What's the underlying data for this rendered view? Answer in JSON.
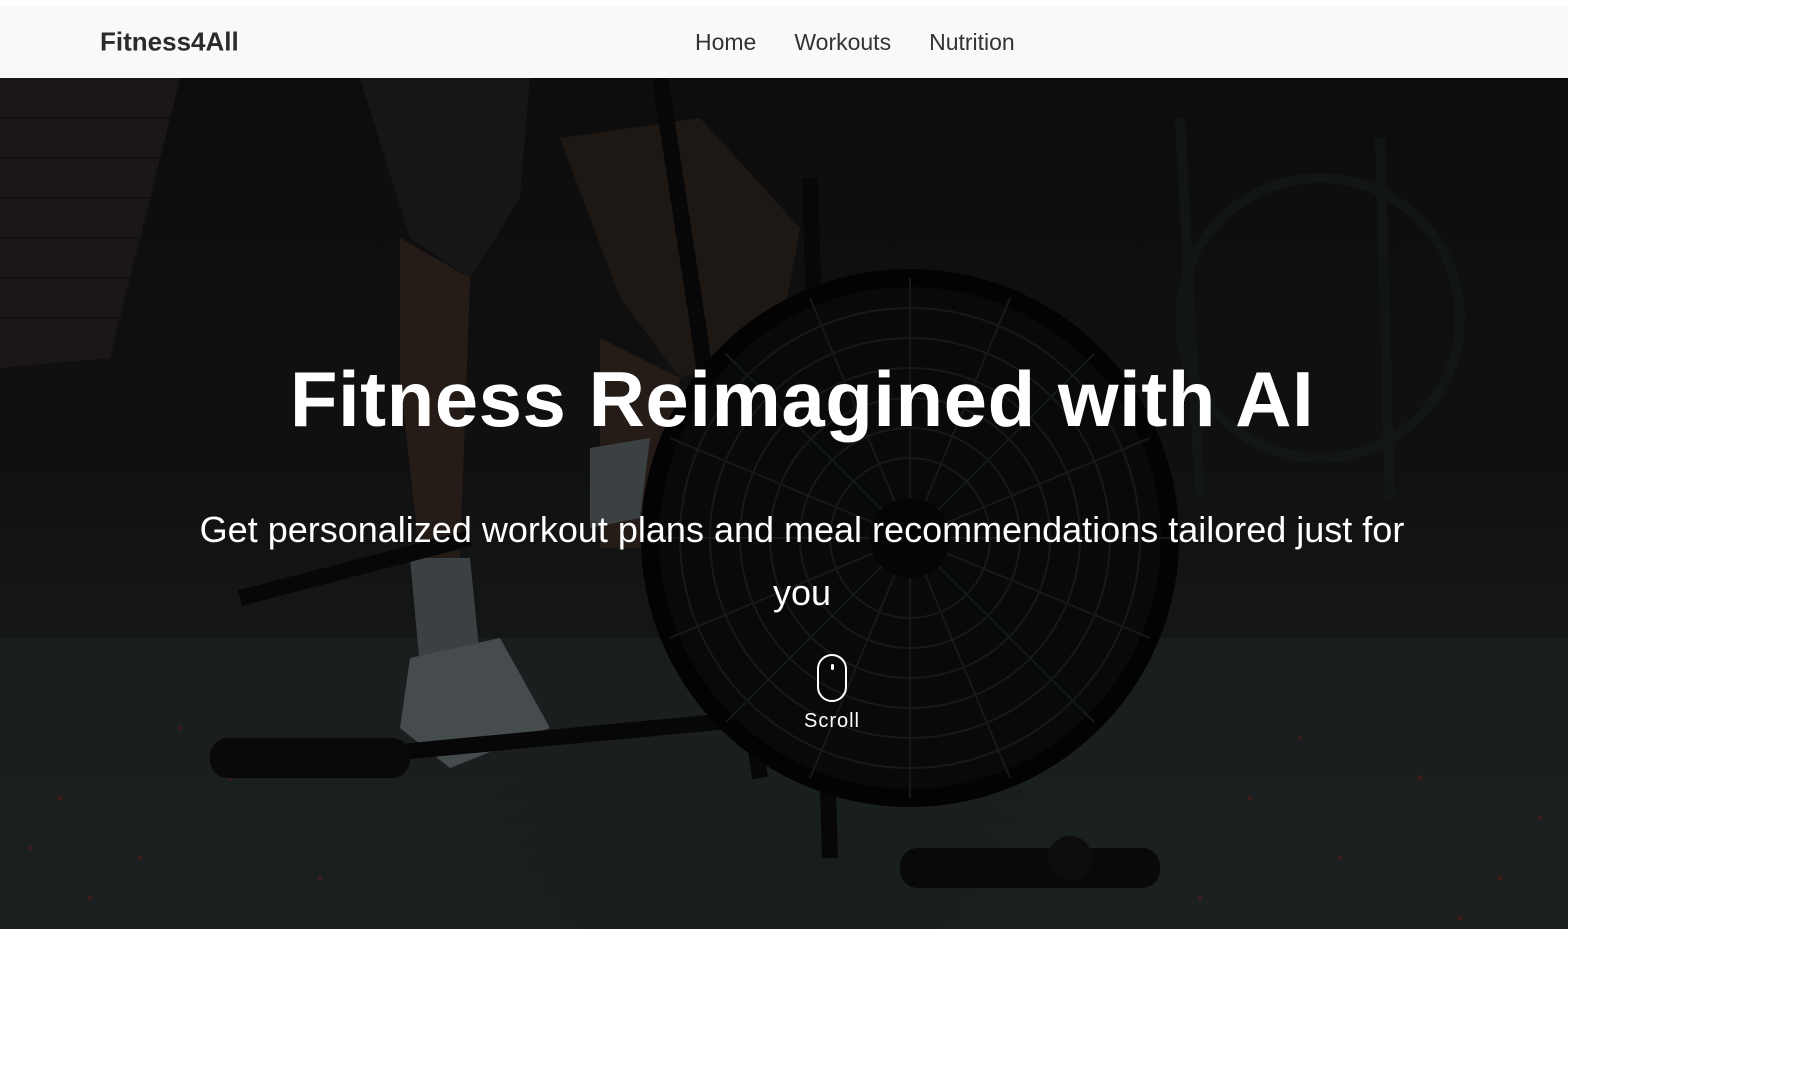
{
  "navbar": {
    "brand": "Fitness4All",
    "links": [
      {
        "label": "Home"
      },
      {
        "label": "Workouts"
      },
      {
        "label": "Nutrition"
      }
    ]
  },
  "hero": {
    "title": "Fitness Reimagined with AI",
    "subtitle": "Get personalized workout plans and meal recommendations tailored just for you",
    "scroll_label": "Scroll",
    "scroll_icon": "mouse-icon",
    "background": "gym-air-bike-photo"
  }
}
